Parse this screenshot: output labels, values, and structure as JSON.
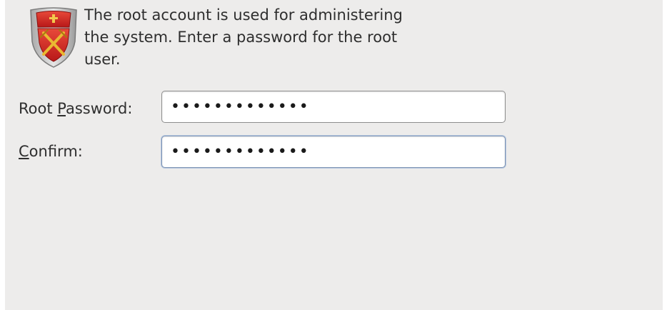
{
  "description": {
    "line1": "The root account is used for administering",
    "line2": "the system.  Enter a password for the root",
    "line3": "user."
  },
  "root_password": {
    "label_before": "Root ",
    "label_mnemonic": "P",
    "label_after": "assword:",
    "value": "1234567890123"
  },
  "confirm_password": {
    "label_mnemonic": "C",
    "label_after": "onfirm:",
    "value": "1234567890123"
  },
  "icon": "root-shield-icon",
  "colors": {
    "panel_background": "#edeceb",
    "shield_red": "#d42b2b",
    "shield_gold": "#e0b030"
  }
}
